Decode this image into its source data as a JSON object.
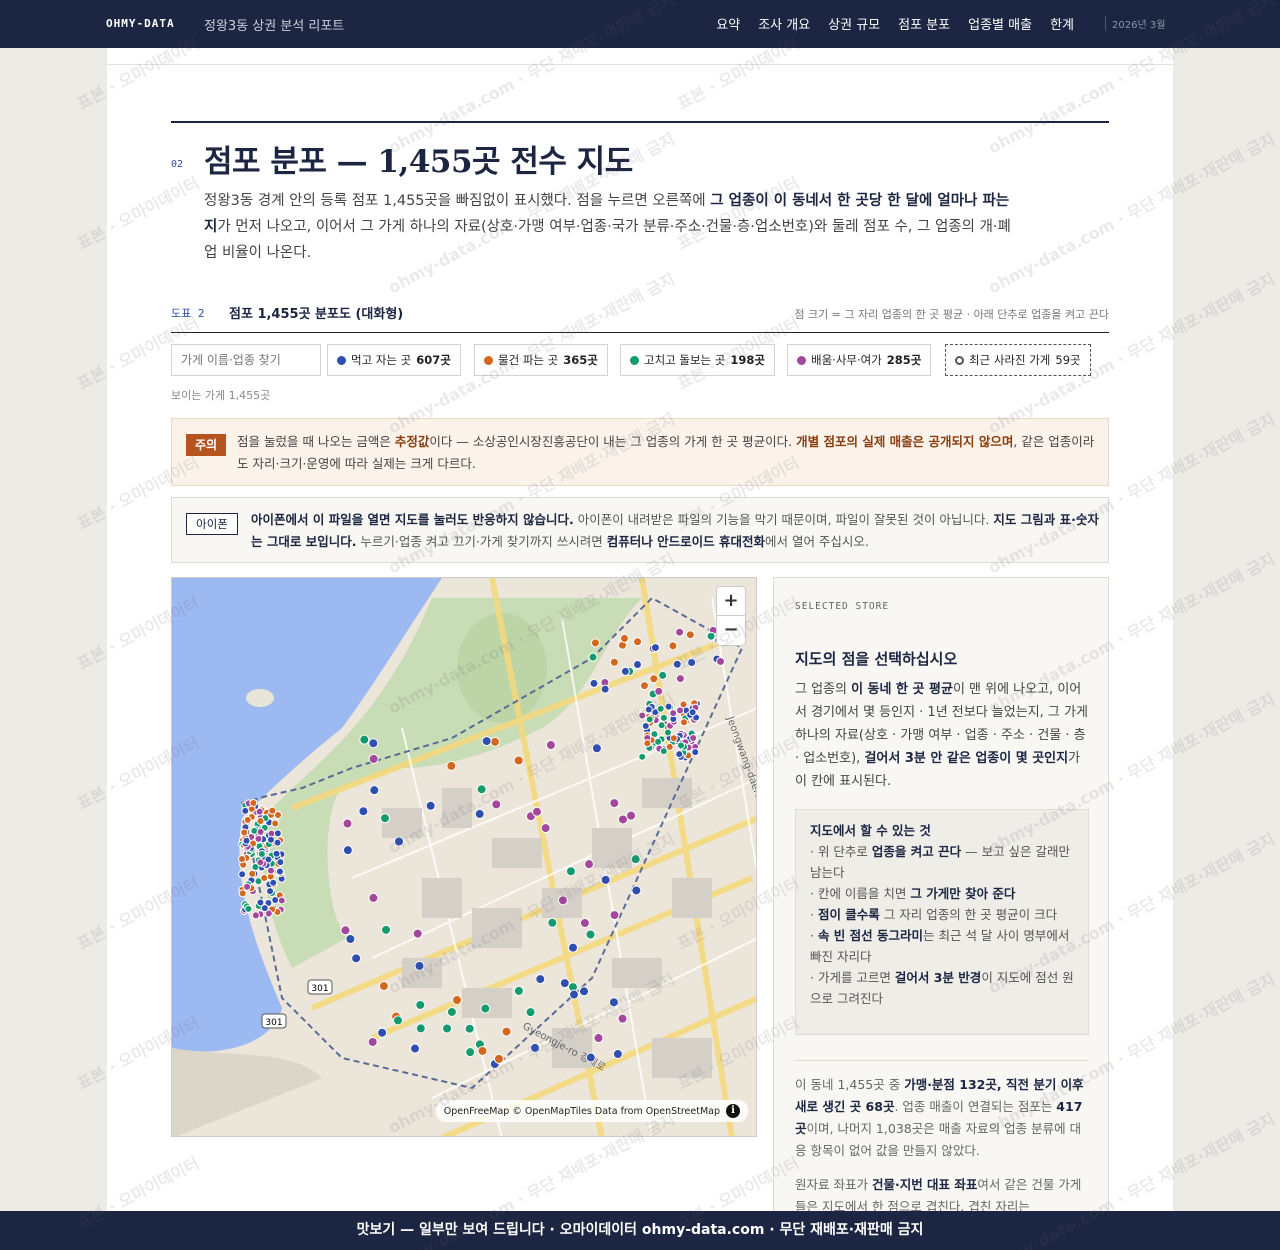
{
  "nav": {
    "brand": "OHMY-DATA",
    "report_title": "정왕3동 상권 분석 리포트",
    "links": [
      "요약",
      "조사 개요",
      "상권 규모",
      "점포 분포",
      "업종별 매출",
      "한계"
    ],
    "date": "2026년 3월"
  },
  "section": {
    "number": "02",
    "title": "점포 분포 — 1,455곳 전수 지도",
    "desc_1": "정왕3동 경계 안의 등록 점포 1,455곳을 빠짐없이 표시했다. 점을 누르면 오른쪽에 ",
    "desc_bold": "그 업종이 이 동네서 한 곳당 한 달에 얼마나 파는지",
    "desc_2": "가 먼저 나오고, 이어서 그 가게 하나의 자료(상호·가맹 여부·업종·국가 분류·주소·건물·층·업소번호)와 둘레 점포 수, 그 업종의 개·폐업 비율이 나온다."
  },
  "figure": {
    "label": "도표 2",
    "title": "점포 1,455곳 분포도 (대화형)",
    "note": "점 크기 = 그 자리 업종의 한 곳 평균 · 아래 단추로 업종을 켜고 끈다"
  },
  "filters": {
    "search_placeholder": "가게 이름·업종 찾기",
    "chips": [
      {
        "label": "먹고 자는 곳",
        "count": "607곳",
        "color": "#2f4fb0"
      },
      {
        "label": "물건 파는 곳",
        "count": "365곳",
        "color": "#d3671e"
      },
      {
        "label": "고치고 돌보는 곳",
        "count": "198곳",
        "color": "#149a6f"
      },
      {
        "label": "배움·사무·여가",
        "count": "285곳",
        "color": "#a3479a"
      }
    ],
    "closed_chip": {
      "label": "최근 사라진 가게",
      "count": "59곳"
    },
    "visible_count": "보이는 가게 1,455곳"
  },
  "warning": {
    "badge": "주의",
    "t1": "점을 눌렀을 때 나오는 금액은 ",
    "b1": "추정값",
    "t2": "이다 — 소상공인시장진흥공단이 내는 그 업종의 가게 한 곳 평균이다. ",
    "b2": "개별 점포의 실제 매출은 공개되지 않으며",
    "t3": ", 같은 업종이라도 자리·크기·운영에 따라 실제는 크게 다르다."
  },
  "ios": {
    "badge": "아이폰",
    "b1": "아이폰에서 이 파일을 열면 지도를 눌러도 반응하지 않습니다.",
    "t1": " 아이폰이 내려받은 파일의 기능을 막기 때문이며, 파일이 잘못된 것이 아닙니다. ",
    "b2": "지도 그림과 표·숫자는 그대로 보입니다.",
    "t2": " 누르기·업종 켜고 끄기·가게 찾기까지 쓰시려면 ",
    "b3": "컴퓨터나 안드로이드 휴대전화",
    "t3": "에서 열어 주십시오."
  },
  "map": {
    "zoom_in": "+",
    "zoom_out": "−",
    "attribution": "OpenFreeMap © OpenMapTiles Data from OpenStreetMap",
    "road_labels": [
      "301",
      "301",
      "Gyeongje-ro 경제로",
      "Jeongwang-daero"
    ]
  },
  "panel": {
    "kicker": "SELECTED STORE",
    "title": "지도의 점을 선택하십시오",
    "p1": "그 업종의 ",
    "p1b": "이 동네 한 곳 평균",
    "p2": "이 맨 위에 나오고, 이어서 경기에서 몇 등인지 · 1년 전보다 늘었는지, 그 가게 하나의 자료(상호 · 가맹 여부 · 업종 · 주소 · 건물 · 층 · 업소번호), ",
    "p2b": "걸어서 3분 안 같은 업종이 몇 곳인지",
    "p3": "가 이 칸에 표시된다.",
    "tips_title": "지도에서 할 수 있는 것",
    "tips": [
      {
        "pre": "· 위 단추로 ",
        "bold": "업종을 켜고 끈다",
        "post": " — 보고 싶은 갈래만 남는다"
      },
      {
        "pre": "· 칸에 이름을 치면 ",
        "bold": "그 가게만 찾아 준다",
        "post": ""
      },
      {
        "pre": "· ",
        "bold": "점이 클수록",
        "post": " 그 자리 업종의 한 곳 평균이 크다"
      },
      {
        "pre": "· ",
        "bold": "속 빈 점선 동그라미",
        "post": "는 최근 석 달 사이 명부에서 빠진 자리다"
      },
      {
        "pre": "· 가게를 고르면 ",
        "bold": "걸어서 3분 반경",
        "post": "이 지도에 점선 원으로 그려진다"
      }
    ],
    "f1": "이 동네 1,455곳 중 ",
    "f1b": "가맹·분점 132곳, 직전 분기 이후 새로 생긴 곳 68곳",
    "f2": ". 업종 매출이 연결되는 점포는 ",
    "f2b": "417곳",
    "f3": "이며, 나머지 1,038곳은 매출 자료의 업종 분류에 대응 항목이 없어 값을 만들지 않았다.",
    "g1": "원자료 좌표가 ",
    "g1b": "건물·지번 대표 좌표",
    "g2": "여서 같은 건물 가게들은 지도에서 한 점으로 겹친다. 겹친 자리는"
  },
  "footer": "맛보기 — 일부만 보여 드립니다 · 오마이데이터 ohmy-data.com · 무단 재배포·재판매 금지",
  "watermark": {
    "a": "표본 · 오마이데이터",
    "b": "ohmy-data.com · 무단 재배포·재판매 금지"
  }
}
